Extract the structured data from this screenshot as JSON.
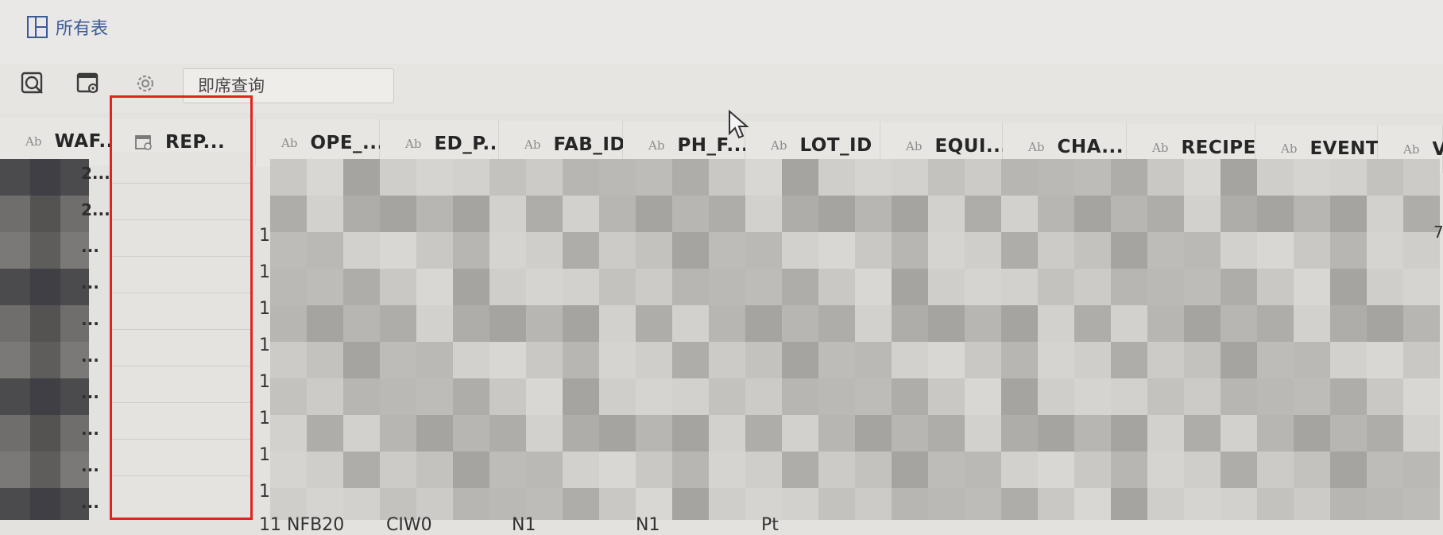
{
  "header": {
    "all_tables_label": "所有表",
    "icons": [
      "layout-panels-icon"
    ]
  },
  "toolbar": {
    "icons": [
      "query-icon",
      "table-settings-icon",
      "gear-icon"
    ],
    "search_placeholder": "即席查询"
  },
  "columns": [
    {
      "type_badge": "Ab",
      "name": "WAF..."
    },
    {
      "type_badge": "table-icon",
      "name": "REP..."
    },
    {
      "type_badge": "Ab",
      "name": "OPE_..."
    },
    {
      "type_badge": "Ab",
      "name": "ED_P..."
    },
    {
      "type_badge": "Ab",
      "name": "FAB_ID"
    },
    {
      "type_badge": "Ab",
      "name": "PH_F..."
    },
    {
      "type_badge": "Ab",
      "name": "LOT_ID"
    },
    {
      "type_badge": "Ab",
      "name": "EQUI..."
    },
    {
      "type_badge": "Ab",
      "name": "CHA..."
    },
    {
      "type_badge": "Ab",
      "name": "RECIPE"
    },
    {
      "type_badge": "Ab",
      "name": "EVENT"
    },
    {
      "type_badge": "Ab",
      "name": "V"
    }
  ],
  "left_column_fragments": [
    "2...",
    "2...",
    "...",
    "...",
    "...",
    "...",
    "...",
    "...",
    "...",
    "..."
  ],
  "row_markers": [
    "1",
    "1",
    "1",
    "1",
    "1",
    "1",
    "1",
    "1"
  ],
  "bottom_row_fragments": [
    "11 NFB20",
    "CIW0",
    "N1",
    "N1",
    "Pt"
  ],
  "right_edge_fragment": "7",
  "highlight": {
    "target_column": "REP...",
    "color": "#e2241f"
  },
  "colors": {
    "accent": "#3a5a98",
    "highlight": "#e2241f"
  }
}
